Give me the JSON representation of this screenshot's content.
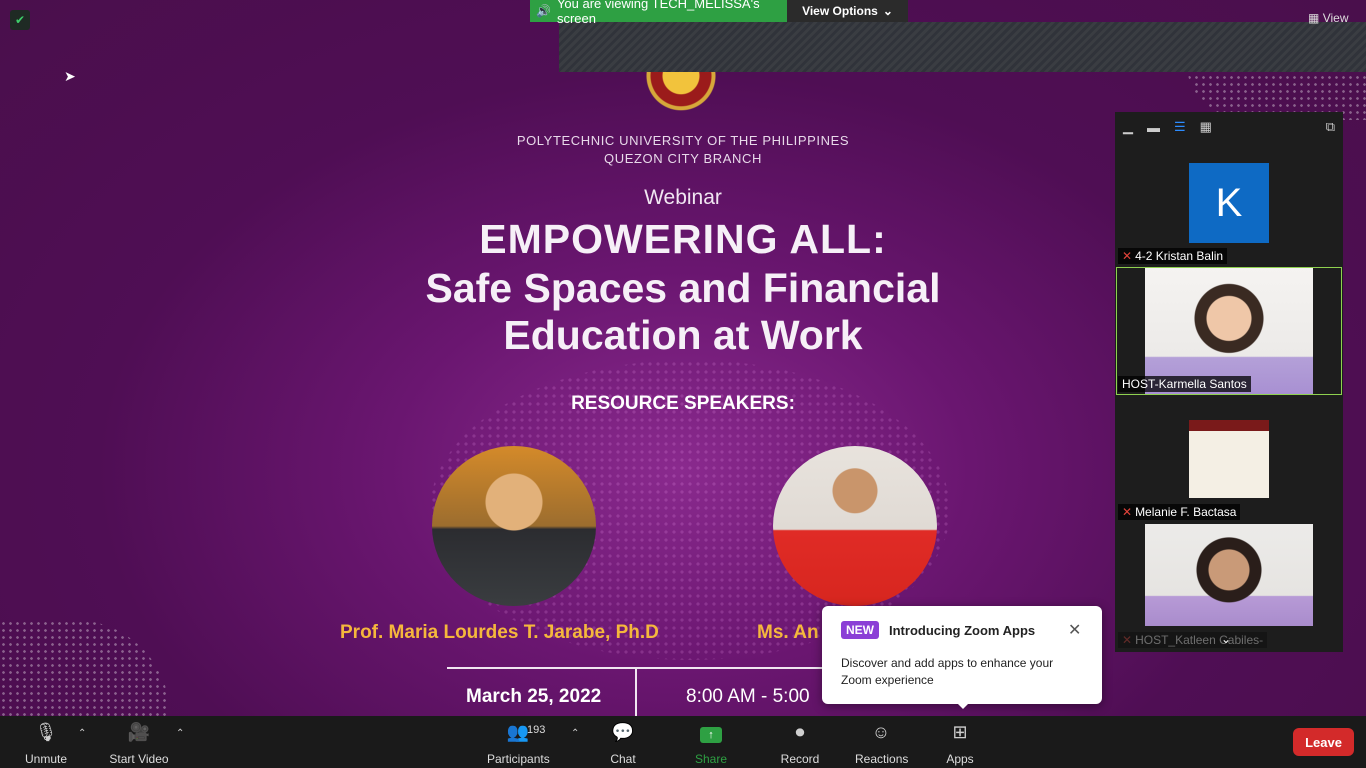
{
  "banner": {
    "viewing_text": "You are viewing TECH_MELISSA's screen",
    "view_options": "View Options",
    "view_button": "View"
  },
  "slide": {
    "university_line1": "POLYTECHNIC UNIVERSITY OF THE PHILIPPINES",
    "university_line2": "QUEZON CITY BRANCH",
    "webinar": "Webinar",
    "title_line1": "EMPOWERING ALL:",
    "title_line2": "Safe Spaces and Financial",
    "title_line3": "Education at Work",
    "resource_speakers": "RESOURCE SPEAKERS:",
    "speaker1_name": "Prof. Maria Lourdes T. Jarabe, Ph.D",
    "speaker2_name_partial": "Ms. An",
    "date": "March 25, 2022",
    "time_partial": "8:00 AM - 5:00"
  },
  "participants_panel": {
    "tiles": [
      {
        "name": "4-2 Kristan Balin",
        "avatar_letter": "K",
        "muted": true
      },
      {
        "name": "HOST-Karmella Santos",
        "muted": false,
        "active_speaker": true
      },
      {
        "name": "Melanie F. Bactasa",
        "muted": true
      },
      {
        "name": "HOST_Katleen Cabiles-",
        "muted": true
      }
    ]
  },
  "popup": {
    "badge": "NEW",
    "title": "Introducing Zoom Apps",
    "body": "Discover and add apps to enhance your Zoom experience"
  },
  "toolbar": {
    "unmute": "Unmute",
    "start_video": "Start Video",
    "participants": "Participants",
    "participants_count": "193",
    "chat": "Chat",
    "share_screen": "Share Screen",
    "record": "Record",
    "reactions": "Reactions",
    "apps": "Apps",
    "leave": "Leave"
  },
  "colors": {
    "share_green": "#2ea043",
    "leave_red": "#d32a2a",
    "active_speaker_border": "#8fd14f",
    "accent_blue": "#2d8cff",
    "new_badge": "#8b3fd6"
  }
}
